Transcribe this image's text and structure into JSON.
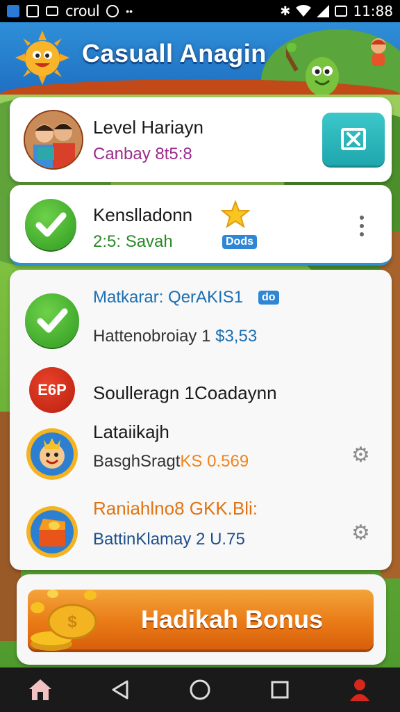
{
  "status_bar": {
    "carrier": "croul",
    "time": "11:88",
    "icons": [
      "app-icon",
      "photo-icon",
      "message-icon",
      "vpn-icon",
      "dots-icon",
      "bluetooth-icon",
      "wifi-icon",
      "signal-icon",
      "battery-icon"
    ]
  },
  "header": {
    "title": "Casuall Anagin",
    "icons": [
      "sun-mascot-icon",
      "green-mascot-icon",
      "kid-character-icon"
    ]
  },
  "profile_card": {
    "name": "Level Hariayn",
    "subtitle": "Canbay 8t5:8",
    "subtitle_color": "#9c2a8a",
    "close_icon": "close-icon"
  },
  "status_card": {
    "name": "Kenslladonn",
    "subtitle": "2:5: Savah",
    "subtitle_color": "#2a8a28",
    "badge": "Dods",
    "star_icon": "star-icon",
    "menu_icon": "more-vertical-icon"
  },
  "list": [
    {
      "title": "Matkarar: QerAKIS1",
      "title_color": "#1c6fb2",
      "badge": "do",
      "detail_prefix": "Hattenobroiay 1 ",
      "detail_value": "$3,53",
      "icon": "check-chat-icon"
    },
    {
      "title": "Soulleragn 1Coadaynn",
      "title_color": "#111111",
      "icon": "eop-badge-icon",
      "icon_text": "E6P"
    },
    {
      "title": "Lataiikajh",
      "title_color": "#111111",
      "detail_prefix": "BasghSragt",
      "detail_value": "KS 0.569",
      "icon": "reward-face-icon",
      "action_icon": "gear-icon"
    },
    {
      "title": "Raniahlno8 GKK.Bli:",
      "title_color": "#e07414",
      "detail_prefix": "BattinKlamay ",
      "detail_value": "2 U.75",
      "icon": "treasure-box-icon",
      "action_icon": "gear-icon"
    }
  ],
  "bonus": {
    "label": "Hadikah Bonus",
    "icon": "coins-icon"
  },
  "nav": [
    {
      "icon": "home-icon"
    },
    {
      "icon": "back-icon"
    },
    {
      "icon": "circle-home-icon"
    },
    {
      "icon": "recents-icon"
    },
    {
      "icon": "profile-icon"
    }
  ],
  "colors": {
    "header_blue": "#1f6fc2",
    "accent_teal": "#1ea7ad",
    "bonus_orange": "#ea7a16",
    "check_green": "#2f9a20",
    "detail_blue": "#1c6fb2"
  }
}
